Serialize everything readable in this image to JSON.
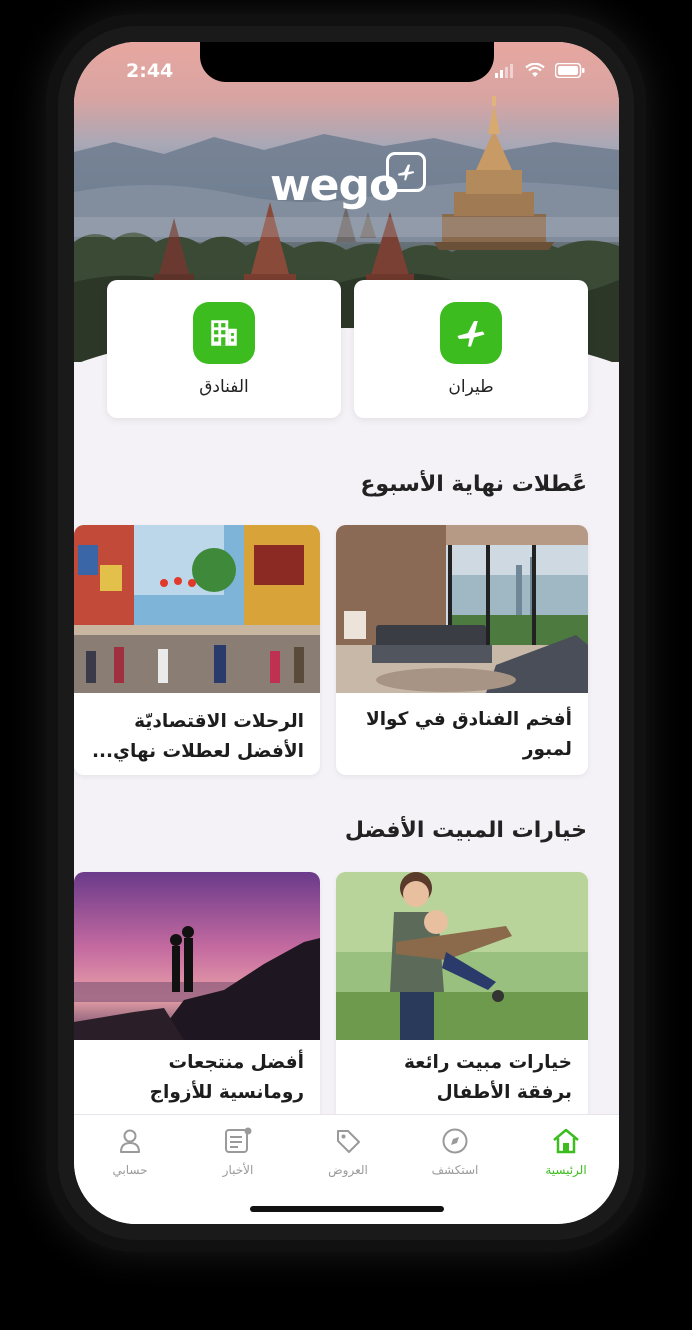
{
  "status_bar": {
    "time": "2:44"
  },
  "hero": {
    "logo": "wego"
  },
  "quick_links": {
    "flights_label": "طيران",
    "hotels_label": "الفنادق"
  },
  "sections": [
    {
      "title": "عًطلات نهاية الأسبوع",
      "cards": [
        {
          "title": "أفخم الفنادق في كوالا لمبور"
        },
        {
          "title": "الرحلات الاقتصاديّة الأفضل لعطلات نهاي..."
        }
      ]
    },
    {
      "title": "خيارات المبيت الأفضل",
      "cards": [
        {
          "title": "خيارات مبيت رائعة برفقة الأطفال"
        },
        {
          "title": "أفضل منتجعات رومانسية للأزواج"
        }
      ]
    }
  ],
  "tabs": [
    {
      "label": "الرئيسية",
      "icon": "home-icon",
      "active": true
    },
    {
      "label": "استكشف",
      "icon": "compass-icon",
      "active": false
    },
    {
      "label": "العروض",
      "icon": "tag-icon",
      "active": false
    },
    {
      "label": "الأخبار",
      "icon": "news-icon",
      "active": false
    },
    {
      "label": "حسابي",
      "icon": "user-icon",
      "active": false
    }
  ],
  "colors": {
    "accent": "#3dbc1f",
    "background": "#f4f2f6"
  }
}
